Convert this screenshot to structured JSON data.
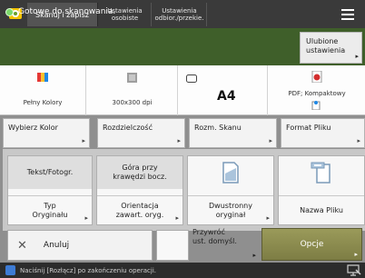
{
  "header": {
    "app_title": "Skanuj i zapisz",
    "tabs": [
      {
        "line1": "Ustawienia",
        "line2": "osobiste"
      },
      {
        "line1": "Ustawienia",
        "line2": "odbior./przekie."
      }
    ],
    "menu_icon": "hamburger-icon"
  },
  "status": {
    "message": "Gotowe do skanowania.",
    "favorites_label_1": "Ulubione",
    "favorites_label_2": "ustawienia"
  },
  "summary": {
    "color": "Pełny Kolory",
    "resolution": "300x300 dpi",
    "size": "A4",
    "format": "PDF; Kompaktowy"
  },
  "settings": {
    "color_btn": "Wybierz Kolor",
    "resolution_btn": "Rozdzielczość",
    "size_btn": "Rozm. Skanu",
    "format_btn": "Format Pliku"
  },
  "options": {
    "type_value": "Tekst/Fotogr.",
    "type_label_1": "Typ",
    "type_label_2": "Oryginału",
    "orient_value_1": "Góra przy",
    "orient_value_2": "krawędzi bocz.",
    "orient_label_1": "Orientacja",
    "orient_label_2": "zawart. oryg.",
    "duplex_label_1": "Dwustronny",
    "duplex_label_2": "oryginał",
    "name_label": "Nazwa Pliku"
  },
  "actions": {
    "cancel": "Anuluj",
    "restore_1": "Przywróć",
    "restore_2": "ust. domyśl.",
    "options": "Opcje"
  },
  "footer": {
    "message": "Naciśnij [Rozłącz] po zakończeniu operacji."
  },
  "colors": {
    "top_bar": "#3a3a3a",
    "status_bar": "#3f5f2a",
    "options_button": "#8a8a4d",
    "status_dot": "#7cd86b"
  }
}
